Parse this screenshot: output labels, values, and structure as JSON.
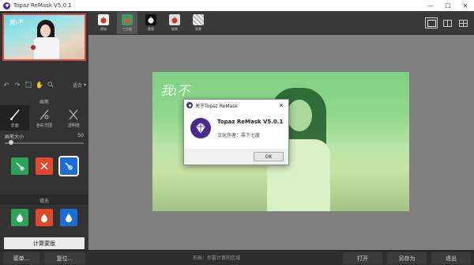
{
  "window": {
    "title": "Topaz ReMask V5.0.1",
    "minimize": "—",
    "maximize": "☐",
    "close": "✕"
  },
  "left": {
    "thumb_text": "我ı不",
    "zoom_label": "适合",
    "brush_section": "画笔",
    "brush_tools": [
      {
        "label": "去画",
        "name": "remove-brush"
      },
      {
        "label": "色彩范围",
        "name": "color-range-brush"
      },
      {
        "label": "透明度",
        "name": "transparency-brush"
      }
    ],
    "brush_size_label": "画笔大小",
    "brush_size_value": "50",
    "brush_size_fraction": 0.08,
    "fill_section": "填充",
    "compute_label": "计算蒙版"
  },
  "toolbar": {
    "tools": [
      {
        "label": "原始",
        "name": "original"
      },
      {
        "label": "三分图",
        "name": "trimap"
      },
      {
        "label": "蒙版",
        "name": "mask"
      },
      {
        "label": "结果",
        "name": "result"
      },
      {
        "label": "背景",
        "name": "background"
      }
    ]
  },
  "dialog": {
    "title": "关于Topaz ReMask",
    "product": "Topaz ReMask V5.0.1",
    "author": "汉化作者：零下七度",
    "ok": "OK"
  },
  "bottom": {
    "menu": "菜单...",
    "reset": "复位...",
    "hint": "形画：你要计算的区域",
    "open": "打开",
    "save_as": "另存为",
    "exit": "退出"
  },
  "colors": {
    "accent_purple": "#4a2a8c",
    "green": "#2ca25a",
    "red": "#e04a2a",
    "blue": "#1c6ed6"
  }
}
